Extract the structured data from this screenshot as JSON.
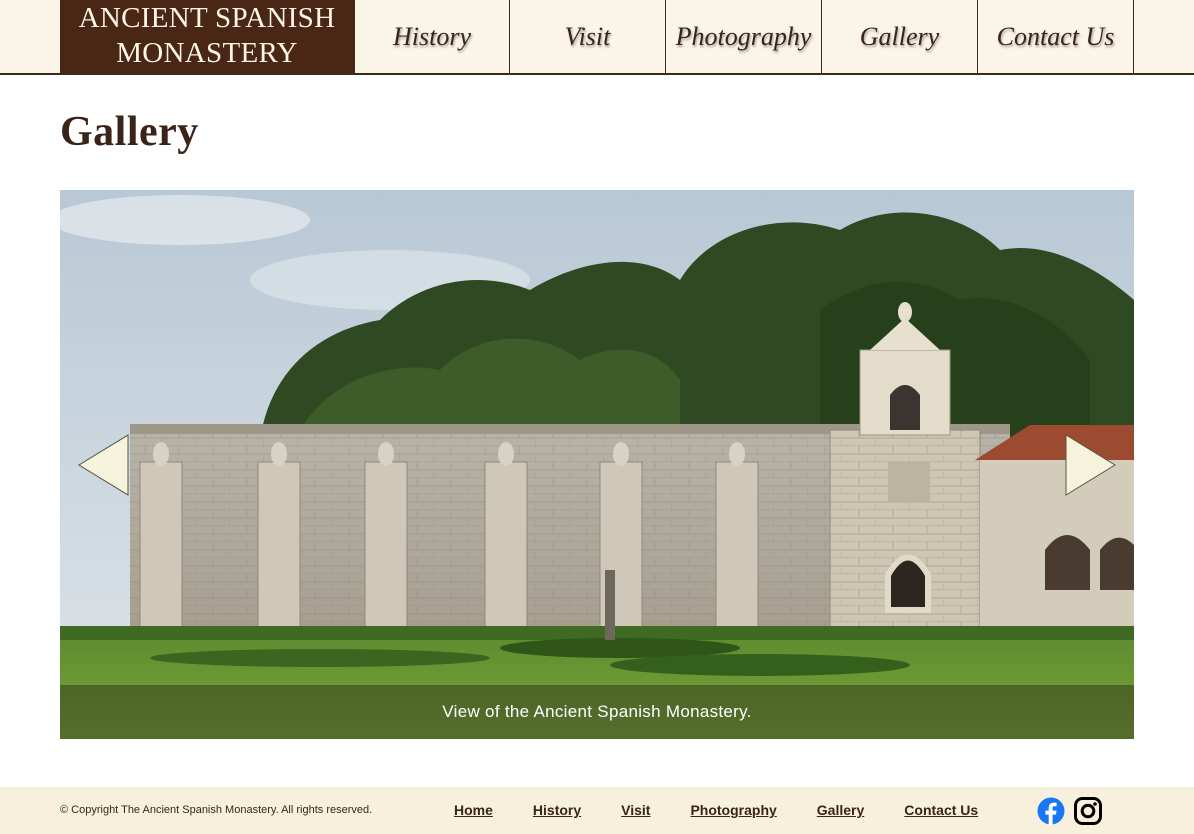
{
  "header": {
    "logo_line1": "ANCIENT SPANISH",
    "logo_line2": "MONASTERY",
    "nav": [
      "History",
      "Visit",
      "Photography",
      "Gallery",
      "Contact Us"
    ]
  },
  "main": {
    "title": "Gallery",
    "slideshow": {
      "caption": "View of the Ancient Spanish Monastery.",
      "prev_icon": "arrow-left-icon",
      "next_icon": "arrow-right-icon",
      "arrow_color": "#f5f3dc"
    }
  },
  "footer": {
    "copyright": "© Copyright The Ancient Spanish Monastery. All rights reserved.",
    "links": [
      "Home",
      "History",
      "Visit",
      "Photography",
      "Gallery",
      "Contact Us"
    ],
    "social": [
      "facebook-icon",
      "instagram-icon"
    ]
  },
  "colors": {
    "brand_brown": "#4a2714",
    "header_bg": "#faf5e6",
    "footer_bg": "#f7f0dc",
    "facebook_blue": "#1877f2"
  }
}
